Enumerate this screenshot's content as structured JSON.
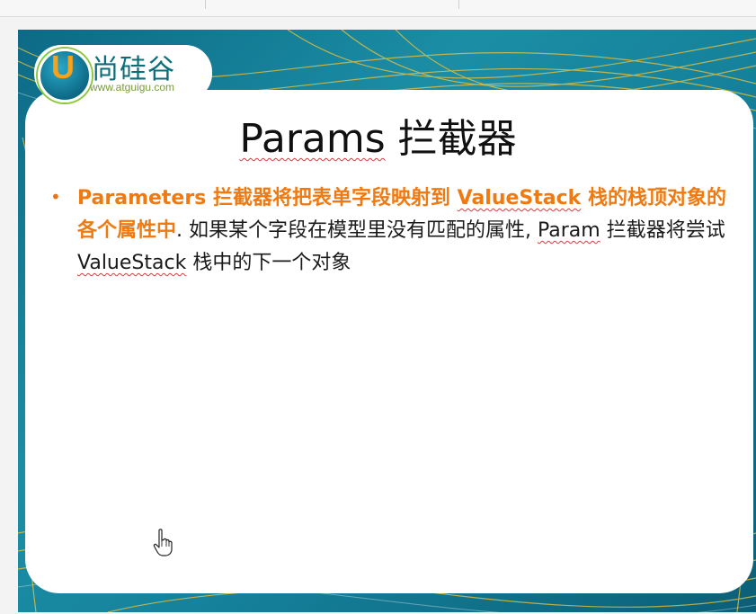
{
  "slide": {
    "logo": {
      "letter": "U",
      "brand_text": "尚硅谷",
      "url_text": "www.atguigu.com"
    },
    "title": {
      "main": "Params",
      "suffix": "拦截器"
    },
    "bullet": {
      "highlight_part1": "Parameters 拦截器将把表单字段映射到 ",
      "highlight_term": "ValueStack",
      "highlight_part2": " 栈的栈顶对象的各个属性中",
      "normal_part1": ". 如果某个字段在模型里没有匹配的属性, ",
      "normal_term1": "Param",
      "normal_part2": " 拦截器将尝试 ",
      "normal_term2": "ValueStack",
      "normal_part3": " 栈中的下一个对象"
    }
  },
  "colors": {
    "accent": "#f07a12",
    "teal": "#15809a",
    "text": "#1a1a1a"
  },
  "icons": {
    "cursor": "hand-pointer-icon"
  }
}
